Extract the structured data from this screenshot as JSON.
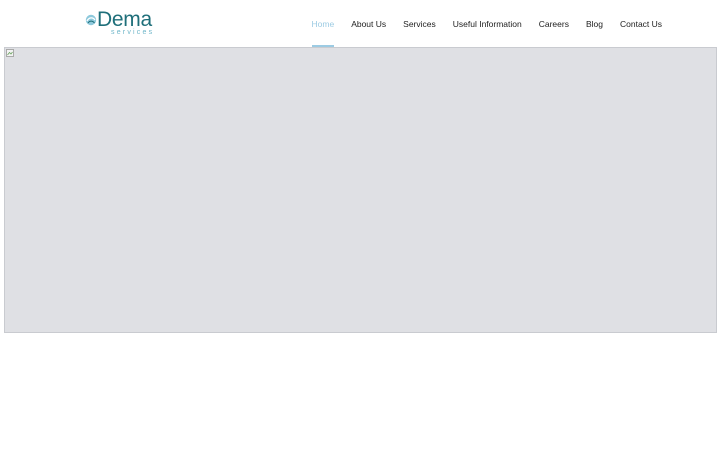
{
  "logo": {
    "name": "Dema",
    "tagline": "services",
    "brand_color": "#1f6f7a",
    "tagline_color": "#6fb6c9",
    "mark_icon": "swirl-logo-icon"
  },
  "nav": {
    "active_color": "#9ccbe3",
    "items": [
      {
        "label": "Home",
        "active": true
      },
      {
        "label": "About Us",
        "active": false
      },
      {
        "label": "Services",
        "active": false
      },
      {
        "label": "Useful Information",
        "active": false
      },
      {
        "label": "Careers",
        "active": false
      },
      {
        "label": "Blog",
        "active": false
      },
      {
        "label": "Contact Us",
        "active": false
      }
    ]
  },
  "hero": {
    "background_color": "#dfe0e4",
    "image_state": "broken-image-icon"
  }
}
